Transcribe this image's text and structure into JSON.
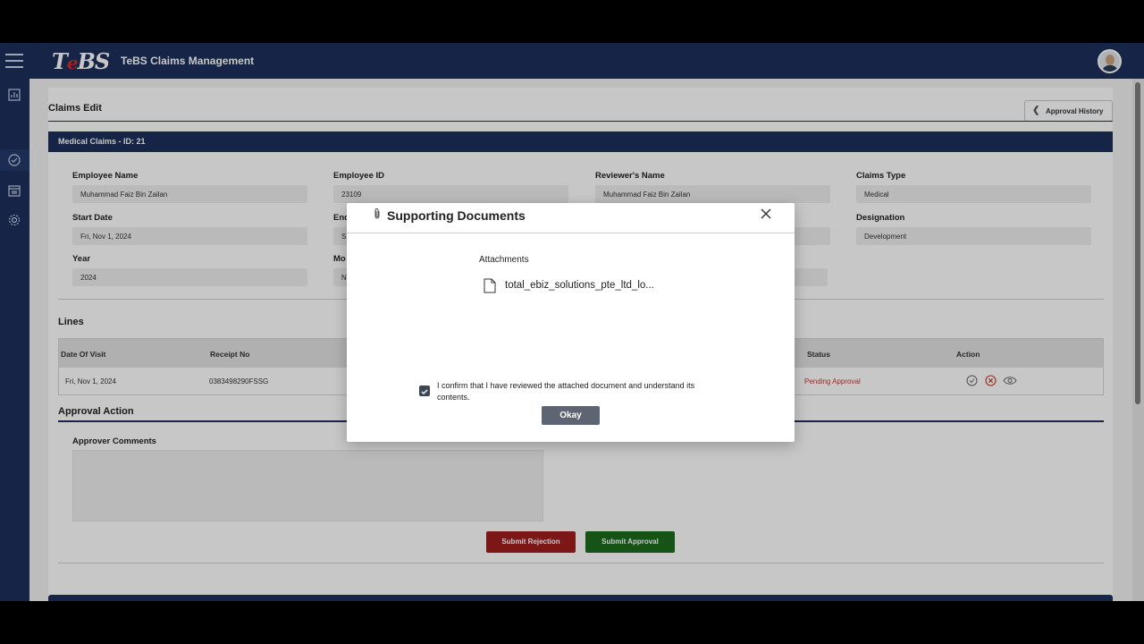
{
  "header": {
    "logo_text": "TeBS",
    "app_title": "TeBS Claims Management"
  },
  "page": {
    "title": "Claims Edit",
    "approval_history_label": "Approval History",
    "section_title": "Medical Claims - ID: 21"
  },
  "fields": {
    "employee_name": {
      "label": "Employee Name",
      "value": "Muhammad Faiz Bin Zailan"
    },
    "employee_id": {
      "label": "Employee ID",
      "value": "23109"
    },
    "reviewer_name": {
      "label": "Reviewer's Name",
      "value": "Muhammad Faiz Bin Zailan"
    },
    "claims_type": {
      "label": "Claims Type",
      "value": "Medical"
    },
    "start_date": {
      "label": "Start Date",
      "value": "Fri, Nov 1, 2024"
    },
    "end_date": {
      "label": "End",
      "value": "S"
    },
    "designation": {
      "label": "Designation",
      "value": "Development"
    },
    "year": {
      "label": "Year",
      "value": "2024"
    },
    "month": {
      "label": "Mo",
      "value": "N"
    }
  },
  "lines": {
    "title": "Lines",
    "columns": [
      "Date Of Visit",
      "Receipt No",
      "Status",
      "Action"
    ],
    "rows": [
      {
        "date": "Fri, Nov 1, 2024",
        "receipt": "0383498290FSSG",
        "status": "Pending Approval"
      }
    ]
  },
  "approval": {
    "title": "Approval Action",
    "comments_label": "Approver Comments",
    "reject_label": "Submit Rejection",
    "approve_label": "Submit Approval"
  },
  "modal": {
    "title": "Supporting Documents",
    "attachments_label": "Attachments",
    "file_name": "total_ebiz_solutions_pte_ltd_lo...",
    "confirm_text": "I confirm that I have reviewed the attached document and understand its contents.",
    "confirm_checked": true,
    "okay_label": "Okay"
  },
  "colors": {
    "brand_navy": "#1b2f5b",
    "reject_red": "#a11e1e",
    "approve_green": "#1d6b1d",
    "pending_red": "#c0392b"
  },
  "icons": [
    "hamburger-icon",
    "chart-icon",
    "check-circle-icon",
    "calendar-icon",
    "gear-icon",
    "chevron-left-icon",
    "paperclip-icon",
    "close-icon",
    "file-icon",
    "approve-icon",
    "reject-icon",
    "view-icon"
  ]
}
